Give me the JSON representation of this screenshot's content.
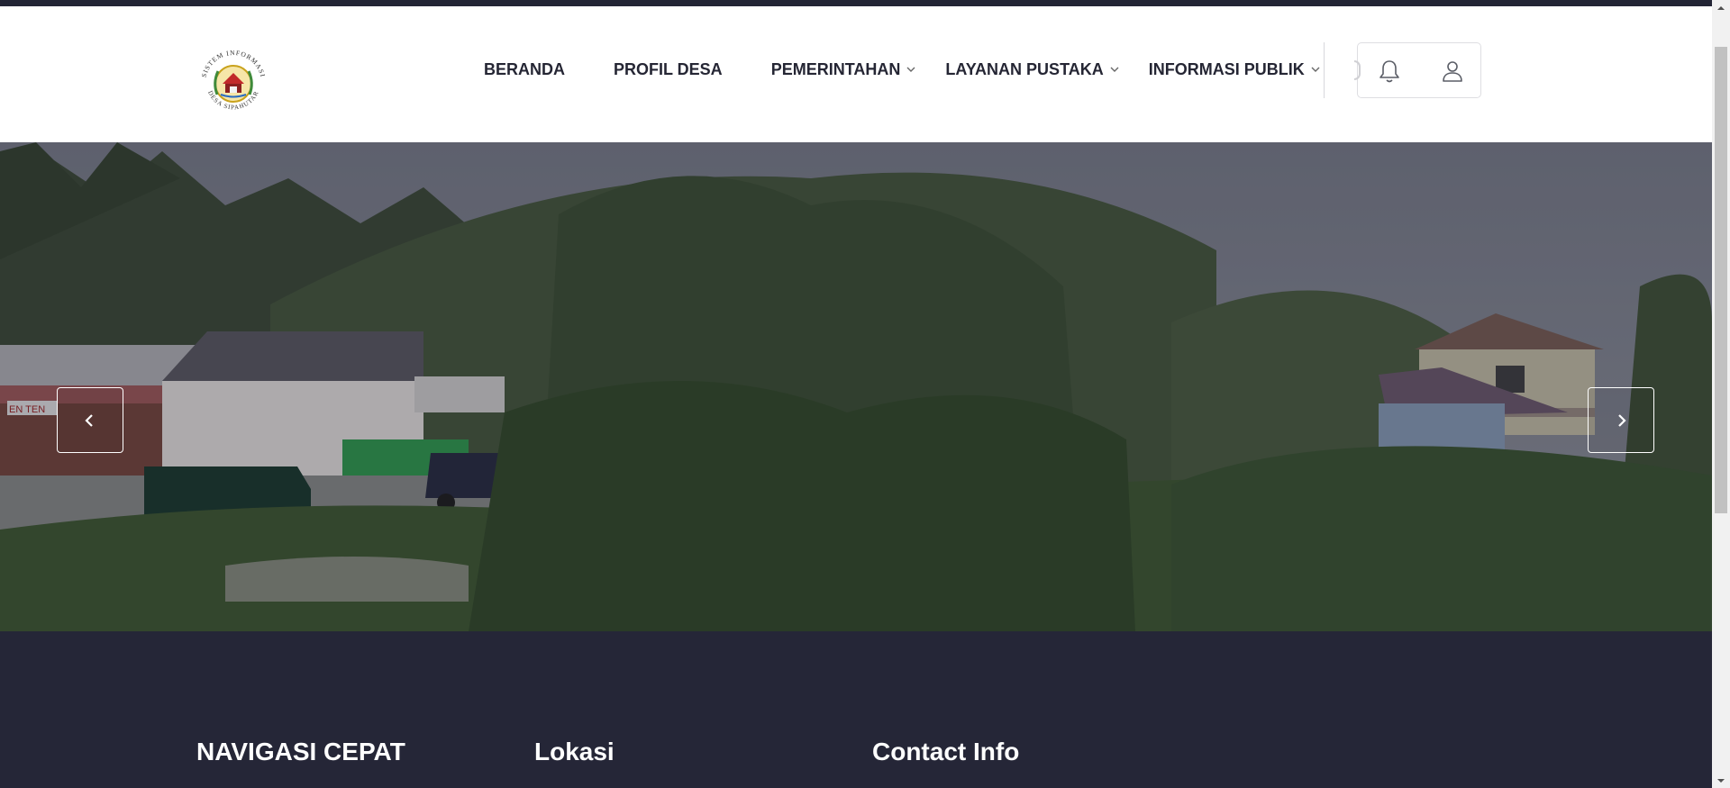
{
  "nav": {
    "items": [
      {
        "label": "BERANDA",
        "has_dropdown": false
      },
      {
        "label": "PROFIL DESA",
        "has_dropdown": false
      },
      {
        "label": "PEMERINTAHAN",
        "has_dropdown": true
      },
      {
        "label": "LAYANAN PUSTAKA",
        "has_dropdown": true
      },
      {
        "label": "INFORMASI PUBLIK",
        "has_dropdown": true
      }
    ]
  },
  "header_icons": [
    "bell-icon",
    "user-icon"
  ],
  "logo": {
    "text_top": "SISTEM INFORMASI",
    "text_bottom": "DESA SIPAHUTAR"
  },
  "hero": {
    "prev_icon": "chevron-left-icon",
    "next_icon": "chevron-right-icon",
    "shop_sign": "EN TEN"
  },
  "footer": {
    "col1_title": "NAVIGASI CEPAT",
    "col2_title": "Lokasi",
    "col3_title": "Contact Info"
  },
  "colors": {
    "dark": "#252637",
    "nav_text": "#252634",
    "white": "#ffffff"
  }
}
